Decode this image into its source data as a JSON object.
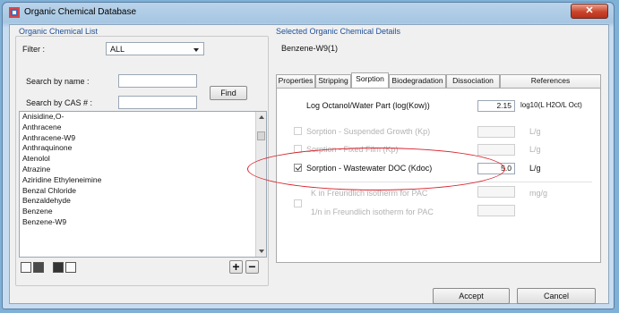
{
  "window": {
    "title": "Organic Chemical Database",
    "close_glyph": "✕"
  },
  "list_panel": {
    "group_title": "Organic Chemical List",
    "filter_label": "Filter :",
    "filter_value": "ALL",
    "search_name_label": "Search by name :",
    "search_cas_label": "Search by CAS # :",
    "search_name_value": "",
    "search_cas_value": "",
    "find_label": "Find",
    "items": [
      "Anisidine,O-",
      "Anthracene",
      "Anthracene-W9",
      "Anthraquinone",
      "Atenolol",
      "Atrazine",
      "Aziridine Ethyleneimine",
      "Benzal Chloride",
      "Benzaldehyde",
      "Benzene",
      "Benzene-W9"
    ],
    "add_glyph": "+",
    "remove_glyph": "−"
  },
  "details": {
    "group_title": "Selected Organic Chemical Details",
    "selected": "Benzene-W9(1)",
    "tabs": [
      "Properties",
      "Stripping",
      "Sorption",
      "Biodegradation",
      "Dissociation",
      "References"
    ],
    "active_tab": "Sorption",
    "log_label": "Log Octanol/Water Part (log(Kow))",
    "log_value": "2.15",
    "log_unit": "log10(L H2O/L Oct)",
    "rows": [
      {
        "label": "Sorption - Suspended Growth (Kp)",
        "value": "",
        "unit": "L/g",
        "checked": false,
        "enabled": false
      },
      {
        "label": "Sorption - Fixed Film (Kp)",
        "value": "",
        "unit": "L/g",
        "checked": false,
        "enabled": false
      },
      {
        "label": "Sorption - Wastewater DOC (Kdoc)",
        "value": "5.0",
        "unit": "L/g",
        "checked": true,
        "enabled": true
      }
    ],
    "freundlich_k_label": "K in Freundlich isotherm for PAC",
    "freundlich_n_label": "1/n in Freundlich isotherm for PAC",
    "freundlich_unit": "mg/g",
    "annotation_color": "#d8202a"
  },
  "buttons": {
    "accept": "Accept",
    "cancel": "Cancel"
  }
}
